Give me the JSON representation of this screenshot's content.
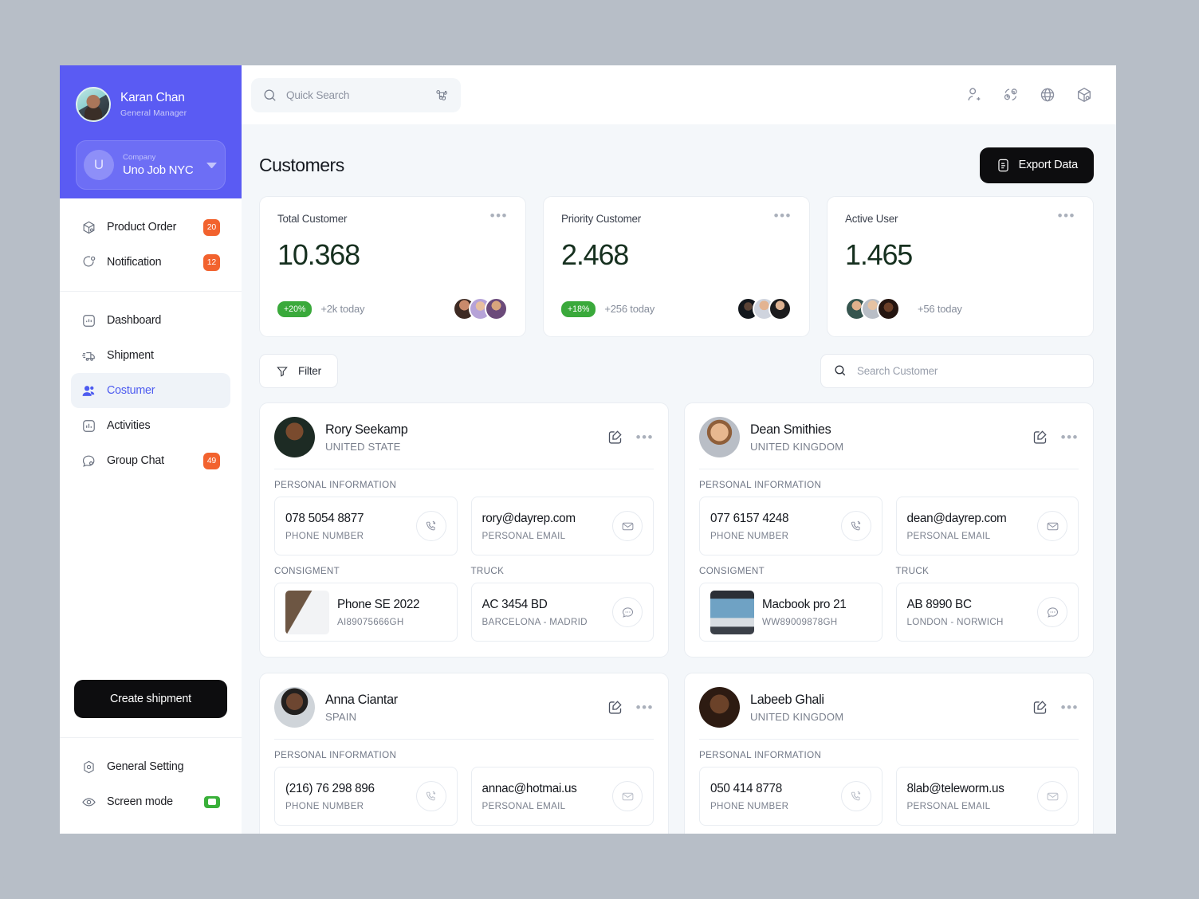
{
  "sidebar": {
    "user": {
      "name": "Karan Chan",
      "role": "General Manager",
      "avatar_icon": "user-avatar"
    },
    "company": {
      "label": "Company",
      "name": "Uno Job NYC",
      "initial": "U",
      "caret_icon": "chevron-down-icon"
    },
    "top_items": [
      {
        "label": "Product Order",
        "badge": "20",
        "icon": "box-icon"
      },
      {
        "label": "Notification",
        "badge": "12",
        "icon": "bell-circle-icon"
      }
    ],
    "nav_items": [
      {
        "label": "Dashboard",
        "badge": "",
        "icon": "chart-square-icon",
        "active": false
      },
      {
        "label": "Shipment",
        "badge": "",
        "icon": "truck-icon",
        "active": false
      },
      {
        "label": "Costumer",
        "badge": "",
        "icon": "users-icon",
        "active": true
      },
      {
        "label": "Activities",
        "badge": "",
        "icon": "bar-chart-icon",
        "active": false
      },
      {
        "label": "Group Chat",
        "badge": "49",
        "icon": "chat-icon",
        "active": false
      }
    ],
    "create_button": "Create shipment",
    "footer_items": [
      {
        "label": "General Setting",
        "icon": "gear-hex-icon",
        "toggle": false
      },
      {
        "label": "Screen mode",
        "icon": "eye-icon",
        "toggle": true
      }
    ]
  },
  "topbar": {
    "search_placeholder": "Quick Search",
    "shortcut_icon": "command-icon",
    "icons": [
      "add-user-icon",
      "transfer-icon",
      "globe-icon",
      "package-icon"
    ]
  },
  "page": {
    "title": "Customers",
    "export_label": "Export Data",
    "export_icon": "document-export-icon"
  },
  "stats": [
    {
      "label": "Total Customer",
      "value": "10.368",
      "pct": "+20%",
      "today": "+2k today",
      "avatars_position": "right",
      "avatars": [
        "avatar-woman-dark-hair",
        "avatar-woman-lilac-hair",
        "avatar-woman-blonde"
      ]
    },
    {
      "label": "Priority Customer",
      "value": "2.468",
      "pct": "+18%",
      "today": "+256 today",
      "avatars_position": "right",
      "avatars": [
        "avatar-man-hat",
        "avatar-man-short-hair",
        "avatar-man-black-shirt"
      ]
    },
    {
      "label": "Active User",
      "value": "1.465",
      "pct": "",
      "today": "+56 today",
      "avatars_position": "left",
      "avatars": [
        "avatar-man-glasses-beard",
        "avatar-man-glasses-bald",
        "avatar-man-afro"
      ]
    }
  ],
  "toolbar": {
    "filter_label": "Filter",
    "filter_icon": "funnel-icon",
    "search_placeholder": "Search Customer",
    "search_icon": "search-icon"
  },
  "section_labels": {
    "personal": "PERSONAL INFORMATION",
    "consigment": "CONSIGMENT",
    "truck": "TRUCK",
    "phone_sub": "PHONE NUMBER",
    "email_sub": "PERSONAL EMAIL"
  },
  "customers": [
    {
      "name": "Rory Seekamp",
      "country": "UNITED STATE",
      "avatar": "avatar-rory",
      "phone": "078 5054 8877",
      "email": "rory@dayrep.com",
      "consigment_title": "Phone SE 2022",
      "consigment_code": "AI89075666GH",
      "consigment_thumb": "thumb-phone",
      "truck_plate": "AC 3454 BD",
      "truck_route": "BARCELONA - MADRID"
    },
    {
      "name": "Dean Smithies",
      "country": "UNITED KINGDOM",
      "avatar": "avatar-dean",
      "phone": "077 6157 4248",
      "email": "dean@dayrep.com",
      "consigment_title": "Macbook pro 21",
      "consigment_code": "WW89009878GH",
      "consigment_thumb": "thumb-macbook",
      "truck_plate": "AB 8990 BC",
      "truck_route": "LONDON - NORWICH"
    },
    {
      "name": "Anna Ciantar",
      "country": "SPAIN",
      "avatar": "avatar-anna",
      "phone": "(216) 76 298 896",
      "email": "annac@hotmai.us",
      "consigment_title": "",
      "consigment_code": "",
      "consigment_thumb": "",
      "truck_plate": "",
      "truck_route": ""
    },
    {
      "name": "Labeeb Ghali",
      "country": "UNITED KINGDOM",
      "avatar": "avatar-labeeb",
      "phone": "050 414 8778",
      "email": "8lab@teleworm.us",
      "consigment_title": "",
      "consigment_code": "",
      "consigment_thumb": "",
      "truck_plate": "",
      "truck_route": ""
    }
  ],
  "colors": {
    "brand_purple": "#5a5bf3",
    "accent_indigo": "#4d5bf0",
    "badge_orange": "#f2622e",
    "green": "#3aa93b",
    "value_dark_green": "#16301f",
    "page_bg": "#f4f7fa",
    "outer_bg": "#b7bec7"
  }
}
